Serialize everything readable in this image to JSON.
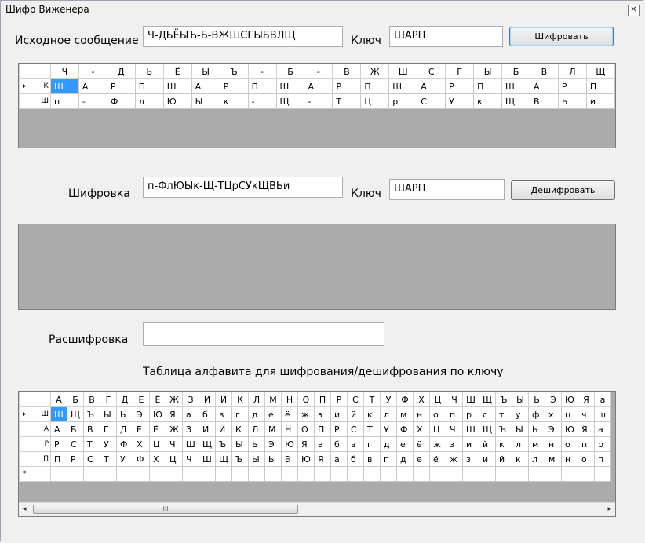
{
  "window": {
    "title": "Шифр Виженера",
    "close_glyph": "✕"
  },
  "encrypt": {
    "source_label": "Исходное сообщение",
    "source_value": "Ч-ДЬЁЫЪ-Б-ВЖШСГЫБВЛЩ",
    "key_label": "Ключ",
    "key_value": "ШАРП",
    "button_label": "Шифровать",
    "grid": {
      "columns": [
        "Ч",
        "-",
        "Д",
        "Ь",
        "Ё",
        "Ы",
        "Ъ",
        "-",
        "Б",
        "-",
        "В",
        "Ж",
        "Ш",
        "С",
        "Г",
        "Ы",
        "Б",
        "В",
        "Л",
        "Щ"
      ],
      "rows": [
        {
          "marker": "▸",
          "header": "К",
          "cells": [
            "Ш",
            "А",
            "Р",
            "П",
            "Ш",
            "А",
            "Р",
            "П",
            "Ш",
            "А",
            "Р",
            "П",
            "Ш",
            "А",
            "Р",
            "П",
            "Ш",
            "А",
            "Р",
            "П"
          ]
        },
        {
          "marker": "",
          "header": "Ш",
          "cells": [
            "п",
            "-",
            "Ф",
            "л",
            "Ю",
            "Ы",
            "к",
            "-",
            "Щ",
            "-",
            "Т",
            "Ц",
            "р",
            "С",
            "У",
            "к",
            "Щ",
            "В",
            "Ь",
            "и"
          ]
        }
      ]
    }
  },
  "decrypt": {
    "cipher_label": "Шифровка",
    "cipher_value": "п-ФлЮЫк-Щ-ТЦрСУкЩВЬи",
    "key_label": "Ключ",
    "key_value": "ШАРП",
    "button_label": "Дешифровать",
    "result_label": "Расшифровка",
    "result_value": ""
  },
  "alphabet": {
    "caption": "Таблица алфавита для шифрования/дешифрования по ключу",
    "columns": [
      "А",
      "Б",
      "В",
      "Г",
      "Д",
      "Е",
      "Ё",
      "Ж",
      "З",
      "И",
      "Й",
      "К",
      "Л",
      "М",
      "Н",
      "О",
      "П",
      "Р",
      "С",
      "Т",
      "У",
      "Ф",
      "Х",
      "Ц",
      "Ч",
      "Ш",
      "Щ",
      "Ъ",
      "Ы",
      "Ь",
      "Э",
      "Ю",
      "Я",
      "а"
    ],
    "rows": [
      {
        "marker": "▸",
        "header": "Ш",
        "cells": [
          "Ш",
          "Щ",
          "Ъ",
          "Ы",
          "Ь",
          "Э",
          "Ю",
          "Я",
          "а",
          "б",
          "в",
          "г",
          "д",
          "е",
          "ё",
          "ж",
          "з",
          "и",
          "й",
          "к",
          "л",
          "м",
          "н",
          "о",
          "п",
          "р",
          "с",
          "т",
          "у",
          "ф",
          "х",
          "ц",
          "ч",
          "ш"
        ]
      },
      {
        "marker": "",
        "header": "А",
        "cells": [
          "А",
          "Б",
          "В",
          "Г",
          "Д",
          "Е",
          "Ё",
          "Ж",
          "З",
          "И",
          "Й",
          "К",
          "Л",
          "М",
          "Н",
          "О",
          "П",
          "Р",
          "С",
          "Т",
          "У",
          "Ф",
          "Х",
          "Ц",
          "Ч",
          "Ш",
          "Щ",
          "Ъ",
          "Ы",
          "Ь",
          "Э",
          "Ю",
          "Я",
          "а"
        ]
      },
      {
        "marker": "",
        "header": "Р",
        "cells": [
          "Р",
          "С",
          "Т",
          "У",
          "Ф",
          "Х",
          "Ц",
          "Ч",
          "Ш",
          "Щ",
          "Ъ",
          "Ы",
          "Ь",
          "Э",
          "Ю",
          "Я",
          "а",
          "б",
          "в",
          "г",
          "д",
          "е",
          "ё",
          "ж",
          "з",
          "и",
          "й",
          "к",
          "л",
          "м",
          "н",
          "о",
          "п",
          "р"
        ]
      },
      {
        "marker": "",
        "header": "П",
        "cells": [
          "П",
          "Р",
          "С",
          "Т",
          "У",
          "Ф",
          "Х",
          "Ц",
          "Ч",
          "Ш",
          "Щ",
          "Ъ",
          "Ы",
          "Ь",
          "Э",
          "Ю",
          "Я",
          "а",
          "б",
          "в",
          "г",
          "д",
          "е",
          "ё",
          "ж",
          "з",
          "и",
          "й",
          "к",
          "л",
          "м",
          "н",
          "о",
          "п"
        ]
      },
      {
        "marker": "*",
        "header": "",
        "cells": [
          "",
          "",
          "",
          "",
          "",
          "",
          "",
          "",
          "",
          "",
          "",
          "",
          "",
          "",
          "",
          "",
          "",
          "",
          "",
          "",
          "",
          "",
          "",
          "",
          "",
          "",
          "",
          "",
          "",
          "",
          "",
          "",
          "",
          ""
        ]
      }
    ],
    "scroll_left": "◂",
    "scroll_right": "▸",
    "scroll_grip": "III"
  }
}
